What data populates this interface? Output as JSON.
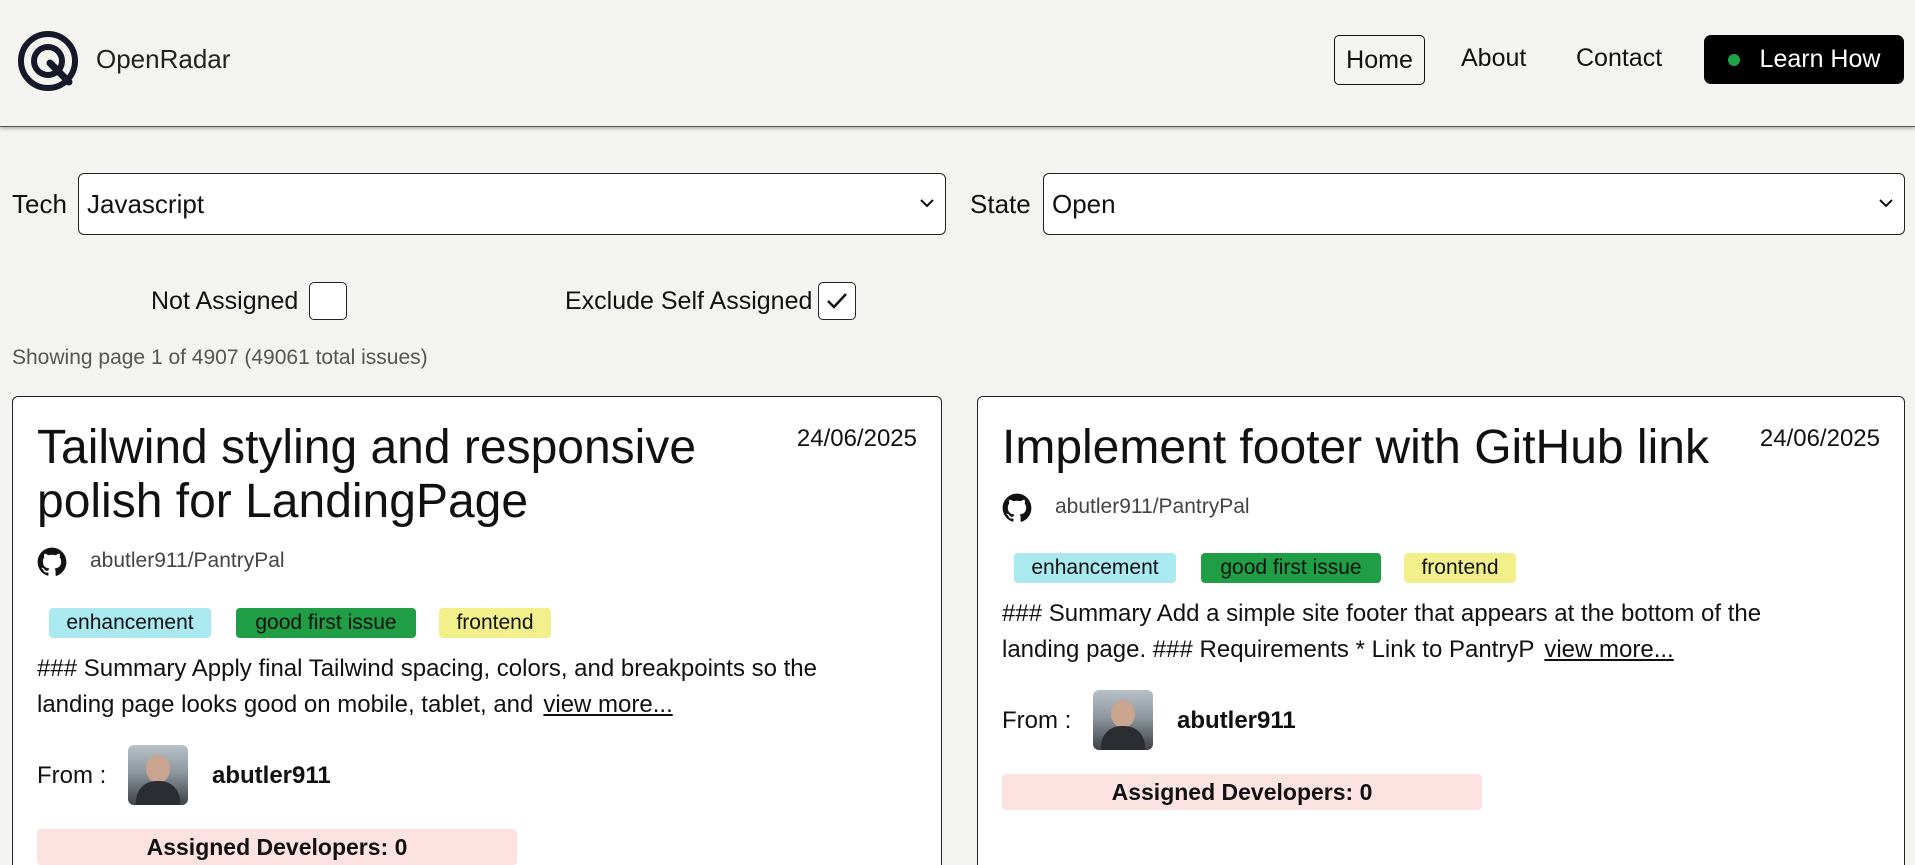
{
  "header": {
    "brand": "OpenRadar",
    "nav": {
      "home": "Home",
      "about": "About",
      "contact": "Contact"
    },
    "cta": "Learn How"
  },
  "filters": {
    "tech_label": "Tech",
    "tech_value": "Javascript",
    "state_label": "State",
    "state_value": "Open",
    "not_assigned_label": "Not Assigned",
    "not_assigned_checked": false,
    "exclude_self_label": "Exclude Self Assigned",
    "exclude_self_checked": true
  },
  "summary": "Showing page 1 of 4907 (49061 total issues)",
  "issues": [
    {
      "title_line1": "Tailwind styling and responsive",
      "title_line2": "polish for LandingPage",
      "date": "24/06/2025",
      "repo": "abutler911/PantryPal",
      "tags": [
        "enhancement",
        "good first issue",
        "frontend"
      ],
      "desc_line1": "### Summary Apply final Tailwind spacing, colors, and breakpoints so the",
      "desc_line2": "landing page looks good on mobile, tablet, and",
      "view_more": "view more...",
      "from_label": "From :",
      "author": "abutler911",
      "assigned": "Assigned Developers: 0"
    },
    {
      "title_line1": "Implement footer with GitHub link",
      "date": "24/06/2025",
      "repo": "abutler911/PantryPal",
      "tags": [
        "enhancement",
        "good first issue",
        "frontend"
      ],
      "desc_line1": "### Summary Add a simple site footer that appears at the bottom of the",
      "desc_line2": "landing page. ### Requirements * Link to PantryP",
      "view_more": "view more...",
      "from_label": "From :",
      "author": "abutler911",
      "assigned": "Assigned Developers: 0"
    }
  ],
  "colors": {
    "tag_enhancement": "#a9e9ef",
    "tag_good_first_issue": "#1f9e45",
    "tag_frontend": "#f1f08a",
    "assigned_bg": "#fde2e2",
    "cta_dot": "#1ea24a"
  }
}
